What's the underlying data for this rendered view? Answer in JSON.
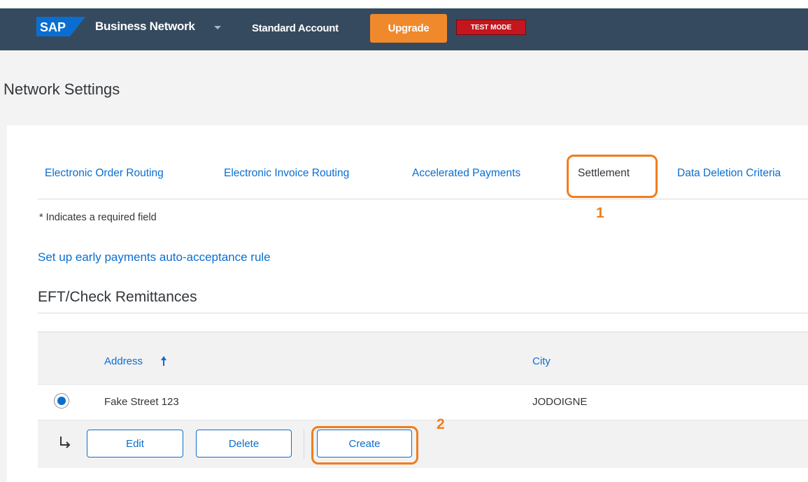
{
  "shell": {
    "logo_text": "SAP",
    "brand": "Business Network",
    "account": "Standard Account",
    "upgrade_label": "Upgrade",
    "test_mode": "TEST MODE",
    "colors": {
      "bar": "#354a5f",
      "upgrade": "#f0892b",
      "test_mode": "#c3161e",
      "logo": "#0a6ed1"
    }
  },
  "page": {
    "title": "Network Settings"
  },
  "tabs": [
    {
      "label": "Electronic Order Routing"
    },
    {
      "label": "Electronic Invoice Routing"
    },
    {
      "label": "Accelerated Payments"
    },
    {
      "label": "Settlement",
      "selected": true
    },
    {
      "label": "Data Deletion Criteria"
    }
  ],
  "callouts": {
    "one": "1",
    "two": "2",
    "color": "#f07d1c"
  },
  "required_note": "* Indicates a required field",
  "early_payments_link": "Set up early payments auto-acceptance rule",
  "section": {
    "title": "EFT/Check Remittances",
    "columns": [
      "Address",
      "City"
    ],
    "sort_icon": "arrow-up-icon",
    "rows": [
      {
        "address": "Fake Street 123",
        "city": "JODOIGNE",
        "selected": true
      }
    ],
    "actions": {
      "edit": "Edit",
      "delete": "Delete",
      "create": "Create"
    }
  }
}
